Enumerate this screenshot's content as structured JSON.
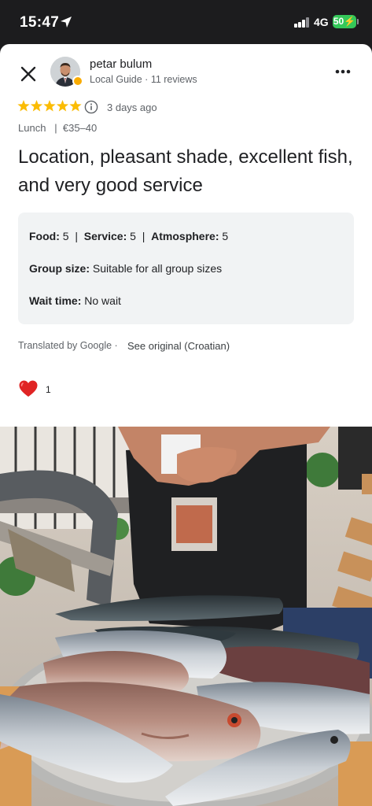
{
  "status_bar": {
    "time": "15:47",
    "network": "4G",
    "battery": "50"
  },
  "review": {
    "author_name": "petar bulum",
    "author_meta": "Local Guide · 11 reviews",
    "rating": 5,
    "date": "3 days ago",
    "meal_type": "Lunch",
    "price": "€35–40",
    "title": "Location, pleasant shade, excellent fish, and very good service",
    "attributes": {
      "food_label": "Food:",
      "food_value": "5",
      "service_label": "Service:",
      "service_value": "5",
      "atmosphere_label": "Atmosphere:",
      "atmosphere_value": "5",
      "group_label": "Group size:",
      "group_value": "Suitable for all group sizes",
      "wait_label": "Wait time:",
      "wait_value": "No wait"
    },
    "translated_by": "Translated by Google ·",
    "see_original": "See original (Croatian)",
    "likes": "1"
  },
  "icons": {
    "close": "close-icon",
    "more": "more-vert-icon",
    "info": "info-icon",
    "heart": "heart-icon",
    "location": "location-arrow-icon"
  },
  "colors": {
    "star": "#fbbc04",
    "heart": "#e02424",
    "attr_bg": "#f1f3f4",
    "battery": "#34c759"
  }
}
